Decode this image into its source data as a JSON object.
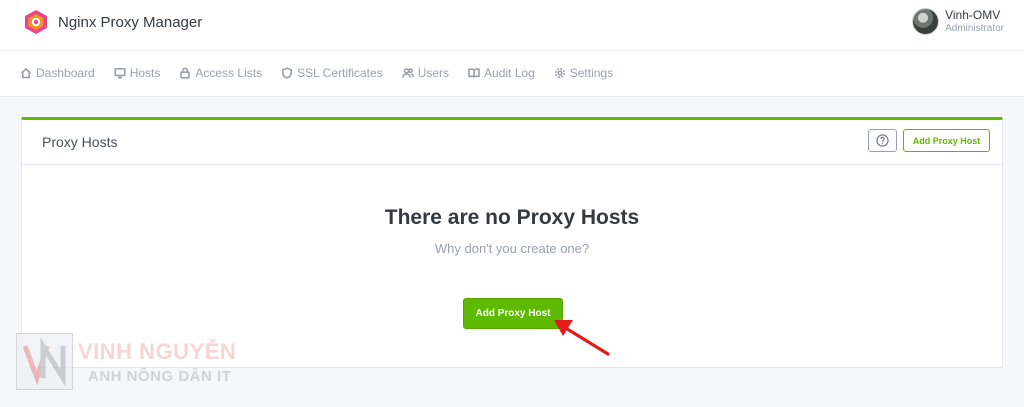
{
  "app": {
    "name": "Nginx Proxy Manager",
    "logo_icon": "nginx-proxy-manager-logo",
    "colors": {
      "accent": "#5eba00",
      "logo_outer": "#e8468a",
      "logo_inner": "#f7941d"
    }
  },
  "user": {
    "name": "Vinh-OMV",
    "role": "Administrator"
  },
  "nav": {
    "items": [
      {
        "label": "Dashboard",
        "icon": "home-icon"
      },
      {
        "label": "Hosts",
        "icon": "monitor-icon"
      },
      {
        "label": "Access Lists",
        "icon": "lock-icon"
      },
      {
        "label": "SSL Certificates",
        "icon": "shield-icon"
      },
      {
        "label": "Users",
        "icon": "users-icon"
      },
      {
        "label": "Audit Log",
        "icon": "book-icon"
      },
      {
        "label": "Settings",
        "icon": "gear-icon"
      }
    ]
  },
  "card": {
    "title": "Proxy Hosts",
    "help_icon": "question-circle-icon",
    "header_add_label": "Add Proxy Host",
    "empty_title": "There are no Proxy Hosts",
    "empty_subtitle": "Why don't you create one?",
    "main_add_label": "Add Proxy Host"
  },
  "watermark": {
    "line1": "VINH NGUYỄN",
    "line2": "ANH NÔNG DÂN IT"
  }
}
